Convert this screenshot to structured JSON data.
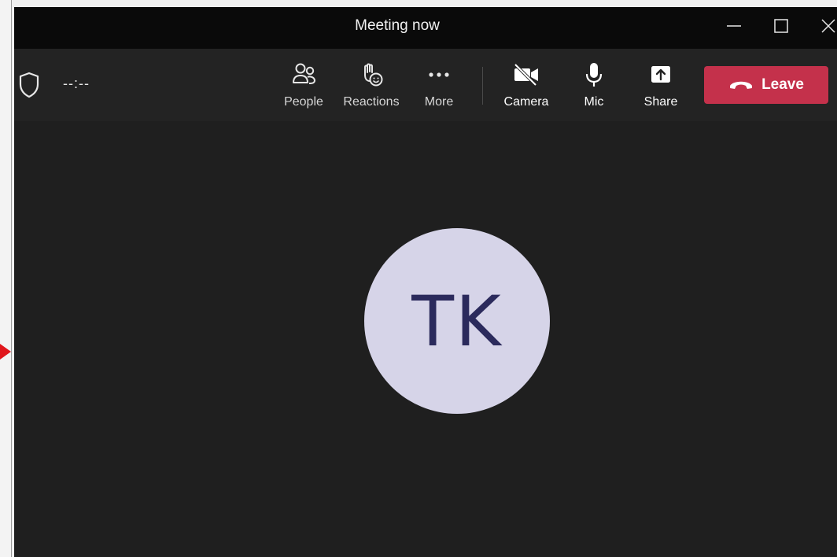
{
  "window": {
    "title": "Meeting now"
  },
  "header": {
    "timer": "--:--"
  },
  "toolbar": {
    "people_label": "People",
    "reactions_label": "Reactions",
    "more_label": "More",
    "camera_label": "Camera",
    "mic_label": "Mic",
    "share_label": "Share",
    "leave_label": "Leave"
  },
  "participant": {
    "initials": "TK"
  },
  "colors": {
    "leave_button": "#c4314b",
    "avatar_bg": "#d6d4e8",
    "avatar_text": "#2b2a5c",
    "stage_bg": "#1f1f1f",
    "titlebar_bg": "#0a0a0a",
    "annotation_arrow": "#e0161b"
  },
  "icons": {
    "shield": "shield-icon",
    "people": "people-icon",
    "reactions": "hand-smile-icon",
    "more": "ellipsis-icon",
    "camera": "camera-off-icon",
    "mic": "microphone-icon",
    "share": "share-screen-icon",
    "leave": "phone-hangup-icon"
  }
}
